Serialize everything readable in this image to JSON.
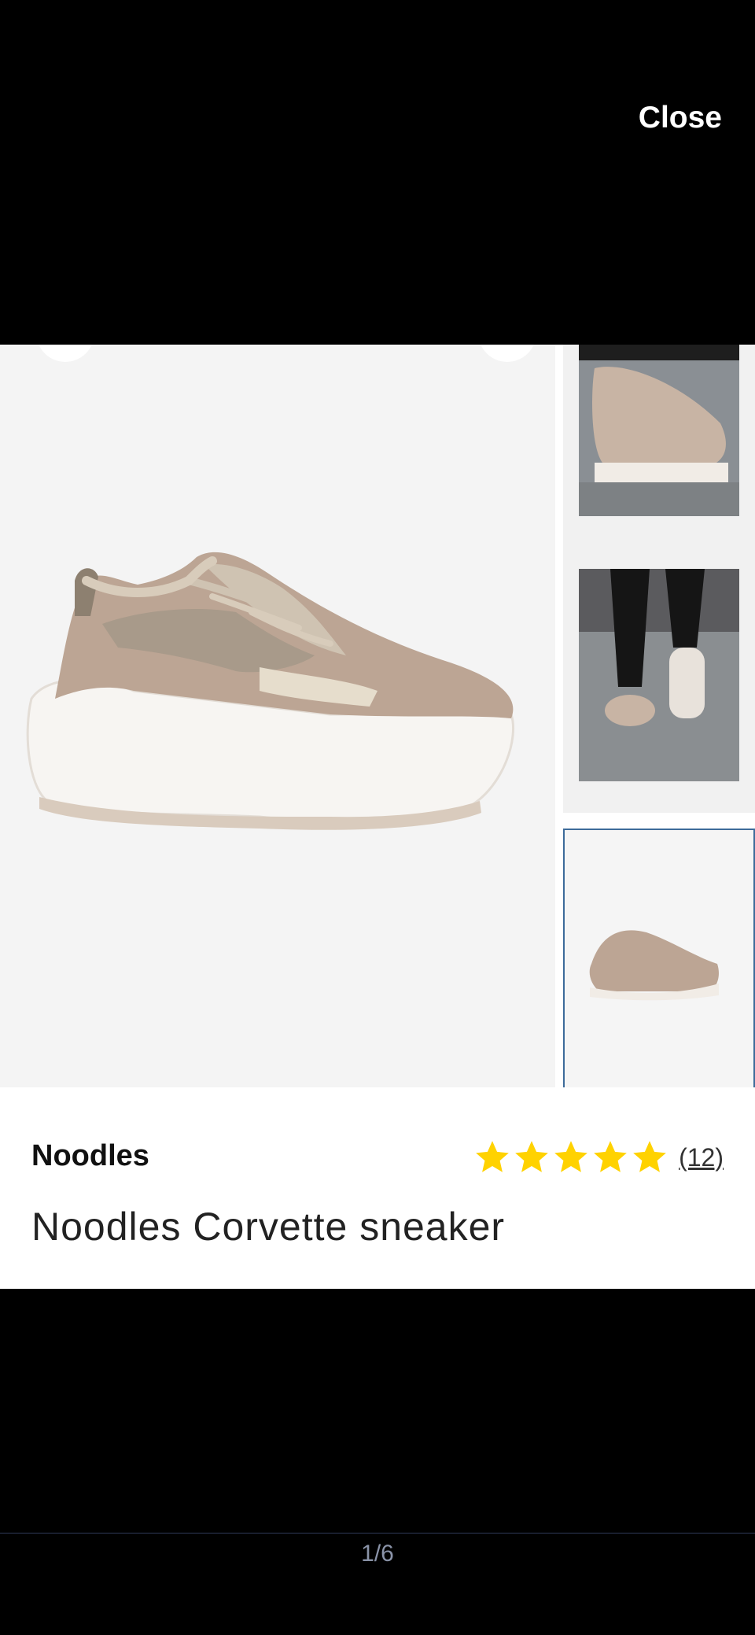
{
  "header": {
    "close_label": "Close"
  },
  "gallery": {
    "main_image": "beige-sneaker-product-photo",
    "thumbnails": [
      {
        "image": "sneaker-worn-side-view-photo",
        "selected": false
      },
      {
        "image": "sneaker-worn-back-view-photo",
        "selected": false
      },
      {
        "image": "beige-sneaker-product-photo",
        "selected": true
      }
    ]
  },
  "product": {
    "brand": "Noodles",
    "name": "Noodles Corvette sneaker",
    "rating": 5,
    "rating_max": 5,
    "review_count": "(12)"
  },
  "pager": {
    "label": "1/6"
  },
  "colors": {
    "star": "#FFD200",
    "selected_border": "#3d6b9a"
  }
}
